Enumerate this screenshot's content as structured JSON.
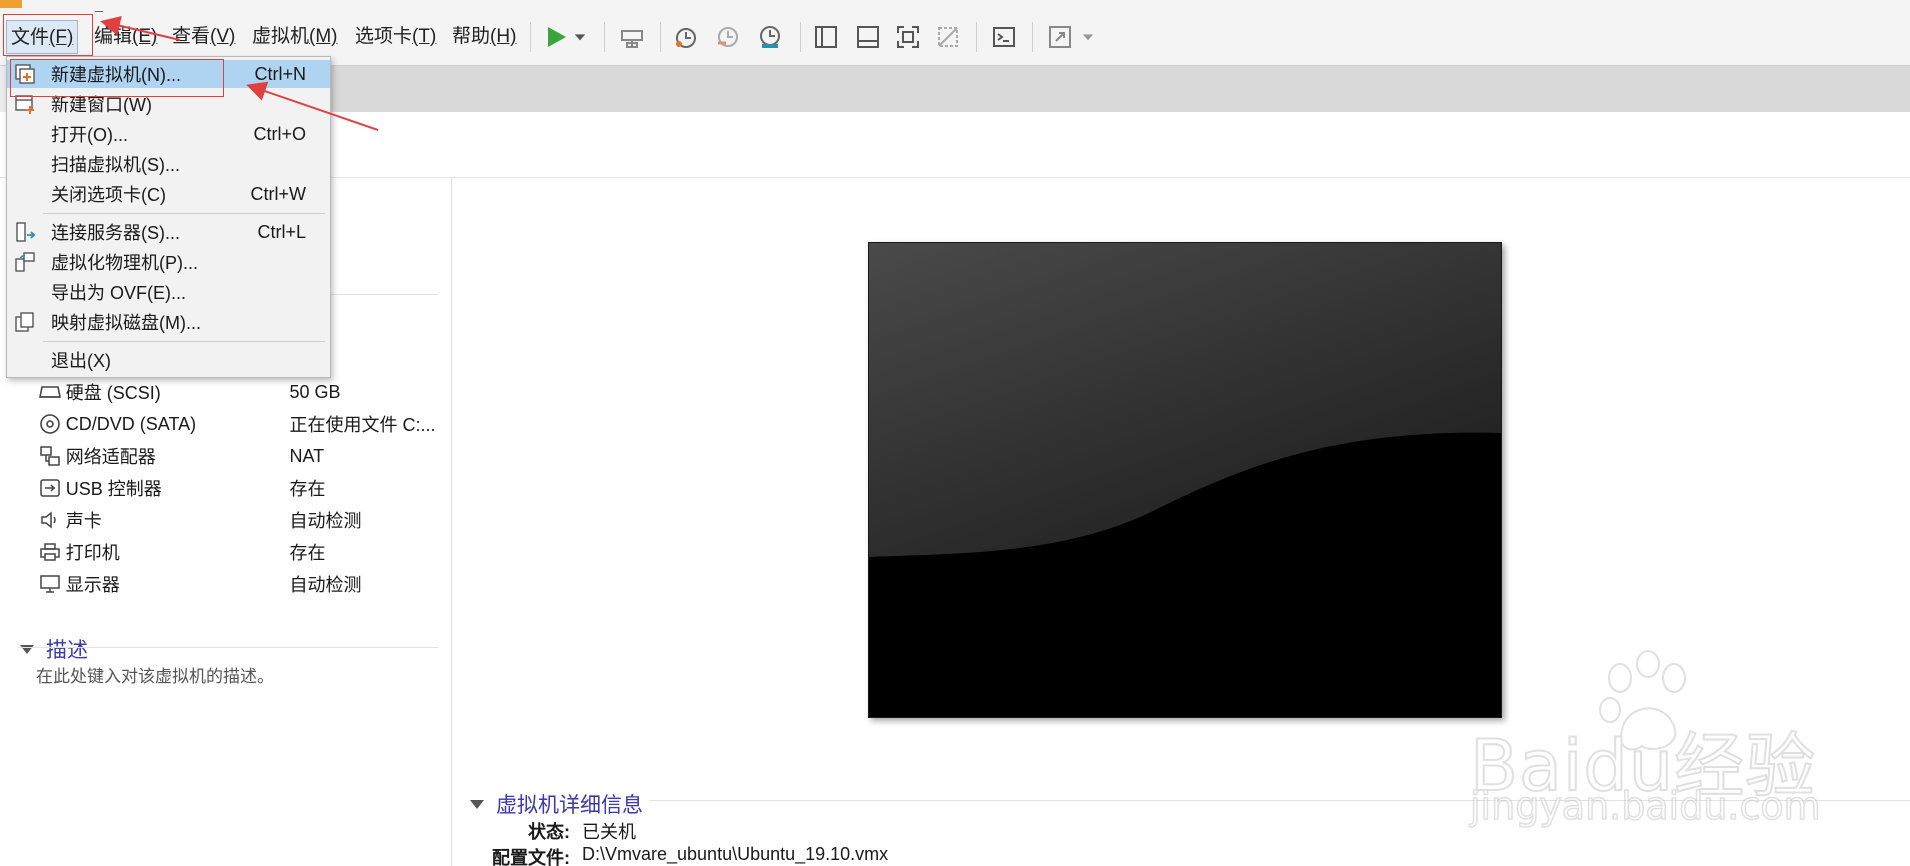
{
  "toolbar": {
    "title_suffix": "_",
    "menus": [
      {
        "label": "文件",
        "mnemonic": "(F)"
      },
      {
        "label": "编辑",
        "mnemonic": "(E)"
      },
      {
        "label": "查看",
        "mnemonic": "(V)"
      },
      {
        "label": "虚拟机",
        "mnemonic": "(M)"
      },
      {
        "label": "选项卡",
        "mnemonic": "(T)"
      },
      {
        "label": "帮助",
        "mnemonic": "(H)"
      }
    ],
    "icons": [
      "play-icon",
      "dropdown-arrow-icon",
      "send-keys-icon",
      "snapshot-icon",
      "revert-snapshot-icon",
      "snapshot-manager-icon",
      "sidebar-view-icon",
      "thumbnail-bar-icon",
      "fullscreen-icon",
      "unity-icon",
      "console-icon",
      "stretch-icon"
    ],
    "play_color": "#3aa53a"
  },
  "file_menu": {
    "items": [
      {
        "label": "新建虚拟机(N)...",
        "shortcut": "Ctrl+N",
        "icon": "new-vm-icon",
        "highlighted": true
      },
      {
        "label": "新建窗口(W)",
        "shortcut": "",
        "icon": "new-window-icon"
      },
      {
        "label": "打开(O)...",
        "shortcut": "Ctrl+O",
        "icon": ""
      },
      {
        "label": "扫描虚拟机(S)...",
        "shortcut": "",
        "icon": ""
      },
      {
        "label": "关闭选项卡(C)",
        "shortcut": "Ctrl+W",
        "icon": ""
      },
      {
        "label": "连接服务器(S)...",
        "shortcut": "Ctrl+L",
        "icon": "connect-server-icon"
      },
      {
        "label": "虚拟化物理机(P)...",
        "shortcut": "",
        "icon": "virtualize-physical-icon"
      },
      {
        "label": "导出为 OVF(E)...",
        "shortcut": "",
        "icon": ""
      },
      {
        "label": "映射虚拟磁盘(M)...",
        "shortcut": "",
        "icon": "map-disk-icon"
      },
      {
        "label": "退出(X)",
        "shortcut": "",
        "icon": ""
      }
    ],
    "highlight_color": "#aed4f2"
  },
  "devices": [
    {
      "name": "硬盘 (SCSI)",
      "value": "50 GB",
      "icon": "hard-disk-icon"
    },
    {
      "name": "CD/DVD (SATA)",
      "value": "正在使用文件 C:...",
      "icon": "cd-dvd-icon"
    },
    {
      "name": "网络适配器",
      "value": "NAT",
      "icon": "network-adapter-icon"
    },
    {
      "name": "USB 控制器",
      "value": "存在",
      "icon": "usb-icon"
    },
    {
      "name": "声卡",
      "value": "自动检测",
      "icon": "sound-icon"
    },
    {
      "name": "打印机",
      "value": "存在",
      "icon": "printer-icon"
    },
    {
      "name": "显示器",
      "value": "自动检测",
      "icon": "display-icon"
    }
  ],
  "description": {
    "heading": "描述",
    "placeholder": "在此处键入对该虚拟机的描述。"
  },
  "details": {
    "heading": "虚拟机详细信息",
    "state_label": "状态:",
    "state_value": "已关机",
    "config_label": "配置文件:",
    "config_value": "D:\\Vmvare_ubuntu\\Ubuntu_19.10.vmx"
  },
  "watermark": {
    "logo": "Baidu经验",
    "url": "jingyan.baidu.com"
  },
  "colors": {
    "section_heading": "#3a3aa8",
    "annotation_red": "#e04040"
  }
}
